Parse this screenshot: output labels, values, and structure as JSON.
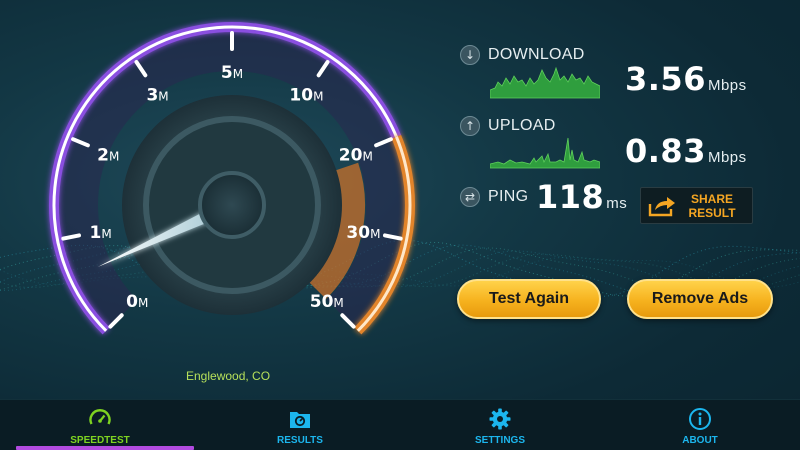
{
  "gauge": {
    "ticks": [
      "0M",
      "1M",
      "2M",
      "3M",
      "5M",
      "10M",
      "20M",
      "30M",
      "50M"
    ],
    "needle_value_mbps": 0.6
  },
  "download": {
    "label": "DOWNLOAD",
    "value": "3.56",
    "unit": "Mbps",
    "icon": "arrow-down-icon"
  },
  "upload": {
    "label": "UPLOAD",
    "value": "0.83",
    "unit": "Mbps",
    "icon": "arrow-up-icon"
  },
  "ping": {
    "label": "PING",
    "value": "118",
    "unit": "ms",
    "icon": "swap-arrows-icon"
  },
  "share": {
    "label": "SHARE\nRESULT",
    "icon": "share-arrow-icon"
  },
  "actions": {
    "test_again": "Test Again",
    "remove_ads": "Remove Ads"
  },
  "location": "Englewood, CO",
  "nav": {
    "items": [
      {
        "label": "SPEEDTEST",
        "icon": "speedometer-icon"
      },
      {
        "label": "RESULTS",
        "icon": "results-folder-icon"
      },
      {
        "label": "SETTINGS",
        "icon": "gear-icon"
      },
      {
        "label": "ABOUT",
        "icon": "info-icon"
      }
    ],
    "active_index": 0
  },
  "colors": {
    "accent_orange": "#f5a623",
    "nav_blue": "#1cb6ee",
    "arc_purple": "#8a4fe0",
    "arc_orange": "#e2842c",
    "sparkline_green": "#3cb043",
    "location_green": "#b6e05a",
    "active_bar": "#b24be0"
  }
}
